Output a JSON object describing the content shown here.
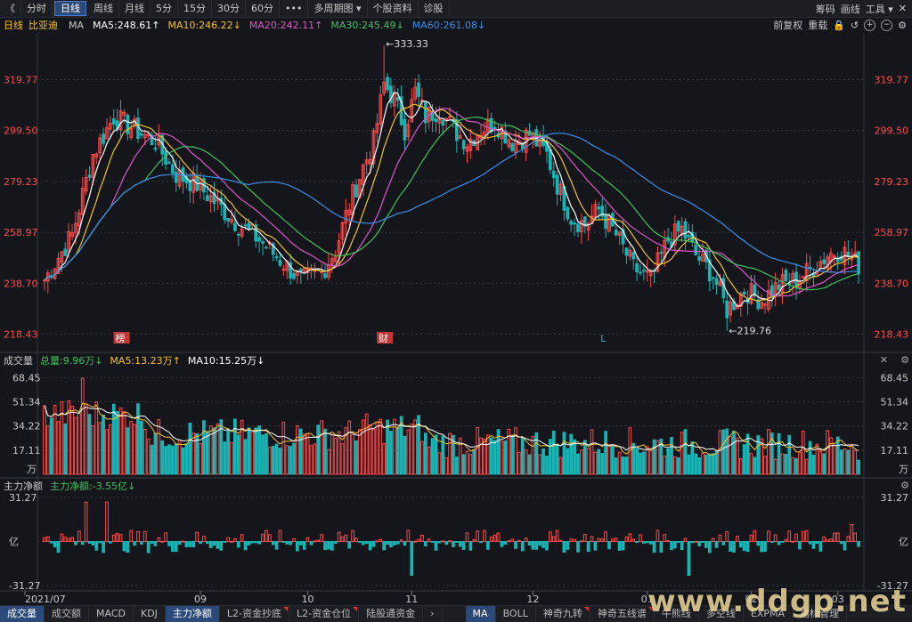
{
  "toolbar": {
    "back": "《",
    "items": [
      "分时",
      "日线",
      "周线",
      "月线",
      "5分",
      "15分",
      "30分",
      "60分",
      "•••",
      "多周期图",
      "个股资料",
      "诊股"
    ],
    "active_index": 1,
    "dropdown_index": 9,
    "right": [
      "筹码",
      "画线",
      "工具",
      "✕"
    ]
  },
  "info": {
    "period": "日线",
    "name": "比亚迪",
    "ma_label": "MA",
    "ma": [
      {
        "label": "MA5:248.61↑",
        "color": "#ffffff"
      },
      {
        "label": "MA10:246.22↓",
        "color": "#f2c12e"
      },
      {
        "label": "MA20:242.11↑",
        "color": "#e055c8"
      },
      {
        "label": "MA30:245.49↓",
        "color": "#3fc25c"
      },
      {
        "label": "MA60:261.08↓",
        "color": "#3a8ee6"
      }
    ],
    "right": [
      "前复权",
      "重载"
    ]
  },
  "colors": {
    "up": "#ff4a4a",
    "down": "#1bb3b3",
    "axis_text": "#ff4a4a",
    "grid": "#343640",
    "vol_axis": "#c8c8c8"
  },
  "price_axis": [
    "319.77",
    "299.50",
    "279.23",
    "258.97",
    "238.70",
    "218.43"
  ],
  "volume_axis": [
    "68.45",
    "51.34",
    "34.22",
    "17.11",
    "万"
  ],
  "flow_axis": [
    "31.27",
    "亿",
    "-31.27"
  ],
  "date_labels": [
    "2021/07",
    "09",
    "10",
    "11",
    "12",
    "01",
    "02",
    "03"
  ],
  "event_marks": [
    "榜",
    "财",
    "L"
  ],
  "max_label": "←333.33",
  "min_label": "←219.76",
  "volume_header": {
    "title": "成交量",
    "total": "总量:9.96万↓",
    "ma5": "MA5:13.23万↑",
    "ma10": "MA10:15.25万↓"
  },
  "flow_header": {
    "title": "主力净额",
    "value": "主力净额:-3.55亿↓"
  },
  "tabs": [
    "成交量",
    "成交额",
    "MACD",
    "KDJ",
    "主力净额",
    "L2-资金抄底",
    "L2-资金仓位",
    "陆股通资金",
    "›",
    "MA",
    "BOLL",
    "神奇九转",
    "神奇五线谱",
    "牛熊线",
    "多空线",
    "EXPMA",
    "指标管理"
  ],
  "tab_active": [
    0,
    4,
    9
  ],
  "tab_flags": [
    5,
    6,
    11,
    12
  ],
  "watermark": "www.ddgp.net",
  "chart_data": {
    "type": "candlestick",
    "x_labels": [
      "2021/07",
      "09",
      "10",
      "11",
      "12",
      "01",
      "02",
      "03"
    ],
    "ylim": [
      214,
      338
    ],
    "yticks": [
      218.43,
      238.7,
      258.97,
      279.23,
      299.5,
      319.77
    ],
    "max_price": 333.33,
    "min_price": 219.76,
    "anchors": [
      [
        0,
        240
      ],
      [
        8,
        258
      ],
      [
        14,
        290
      ],
      [
        20,
        305
      ],
      [
        26,
        300
      ],
      [
        32,
        295
      ],
      [
        38,
        282
      ],
      [
        44,
        278
      ],
      [
        50,
        270
      ],
      [
        56,
        262
      ],
      [
        62,
        256
      ],
      [
        68,
        248
      ],
      [
        74,
        240
      ],
      [
        80,
        243
      ],
      [
        84,
        252
      ],
      [
        88,
        270
      ],
      [
        92,
        285
      ],
      [
        95,
        295
      ],
      [
        98,
        318
      ],
      [
        101,
        312
      ],
      [
        104,
        300
      ],
      [
        107,
        315
      ],
      [
        110,
        305
      ],
      [
        114,
        308
      ],
      [
        118,
        300
      ],
      [
        122,
        295
      ],
      [
        126,
        300
      ],
      [
        130,
        303
      ],
      [
        135,
        295
      ],
      [
        140,
        298
      ],
      [
        145,
        290
      ],
      [
        148,
        278
      ],
      [
        152,
        265
      ],
      [
        156,
        262
      ],
      [
        160,
        268
      ],
      [
        165,
        258
      ],
      [
        170,
        245
      ],
      [
        175,
        240
      ],
      [
        180,
        256
      ],
      [
        184,
        260
      ],
      [
        188,
        250
      ],
      [
        193,
        242
      ],
      [
        197,
        228
      ],
      [
        202,
        236
      ],
      [
        207,
        232
      ],
      [
        212,
        238
      ],
      [
        217,
        240
      ],
      [
        222,
        245
      ],
      [
        226,
        250
      ],
      [
        230,
        252
      ],
      [
        235,
        246
      ]
    ],
    "ma_names": [
      "MA5",
      "MA10",
      "MA20",
      "MA30",
      "MA60"
    ],
    "volume_ylim": [
      0,
      75
    ],
    "volume_yticks": [
      17.11,
      34.22,
      51.34,
      68.45
    ],
    "volume_last": 9.96,
    "flow_ylim": [
      -31.27,
      31.27
    ],
    "flow_last": -3.55
  }
}
